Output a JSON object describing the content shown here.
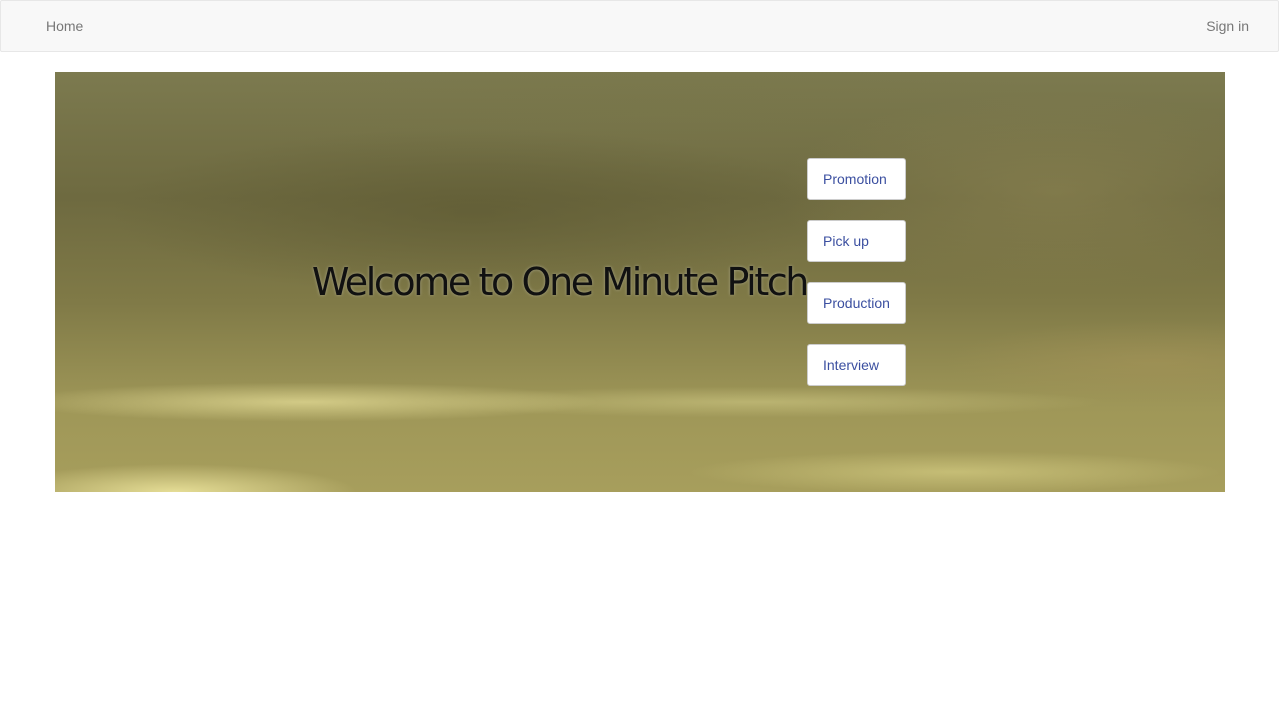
{
  "navbar": {
    "home_label": "Home",
    "signin_label": "Sign in"
  },
  "hero": {
    "title": "Welcome to One Minute Pitch",
    "buttons": [
      {
        "label": "Promotion"
      },
      {
        "label": "Pick up"
      },
      {
        "label": "Production"
      },
      {
        "label": "Interview"
      }
    ]
  },
  "colors": {
    "navbar_bg": "#f8f8f8",
    "nav_link": "#777777",
    "button_text": "#3b4fa0",
    "hero_tone": "#7c7a4f"
  }
}
